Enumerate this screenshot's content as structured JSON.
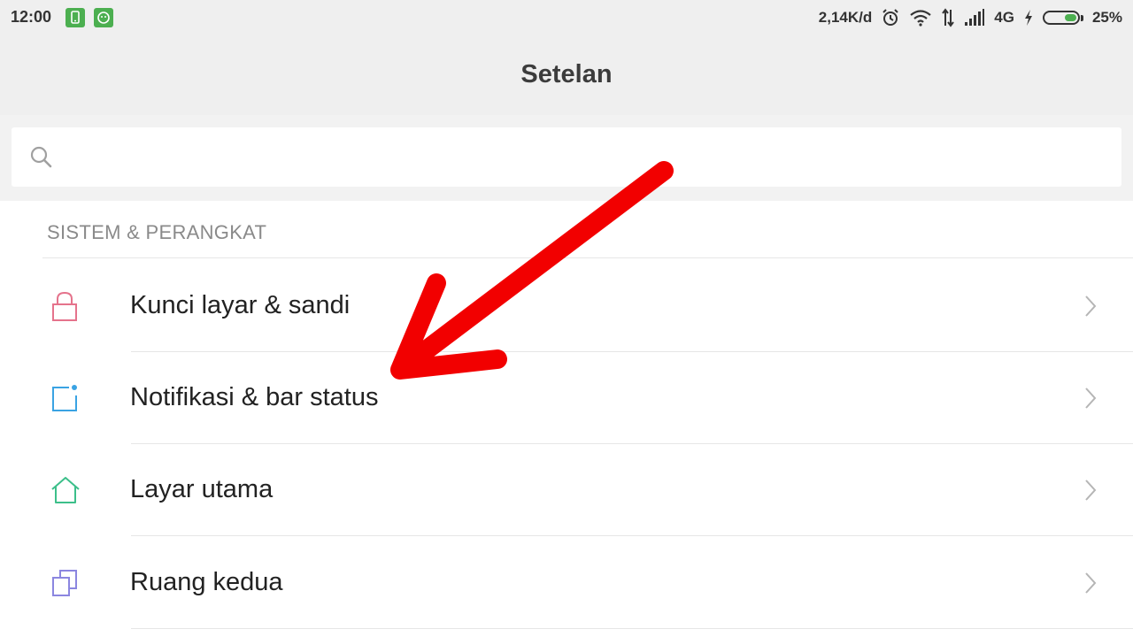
{
  "status_bar": {
    "time": "12:00",
    "net_speed": "2,14K/d",
    "network_type": "4G",
    "battery_text": "25%",
    "battery_level": 0.25,
    "icons": [
      "notification-app-icon",
      "notification-app-icon",
      "alarm-icon",
      "wifi-icon",
      "data-transfer-icon",
      "signal-icon",
      "charging-icon",
      "battery-icon"
    ]
  },
  "header": {
    "title": "Setelan"
  },
  "search": {
    "placeholder": "",
    "value": "",
    "icon": "search-icon"
  },
  "section": {
    "title": "SISTEM & PERANGKAT",
    "items": [
      {
        "label": "Kunci layar & sandi",
        "icon": "lock-icon",
        "color": "#e5738c"
      },
      {
        "label": "Notifikasi & bar status",
        "icon": "notification-icon",
        "color": "#3aa3e3"
      },
      {
        "label": "Layar utama",
        "icon": "home-icon",
        "color": "#3cbf8a"
      },
      {
        "label": "Ruang kedua",
        "icon": "second-space-icon",
        "color": "#8b86e0"
      }
    ]
  },
  "annotation": {
    "color": "#f20000",
    "type": "red-arrow"
  }
}
